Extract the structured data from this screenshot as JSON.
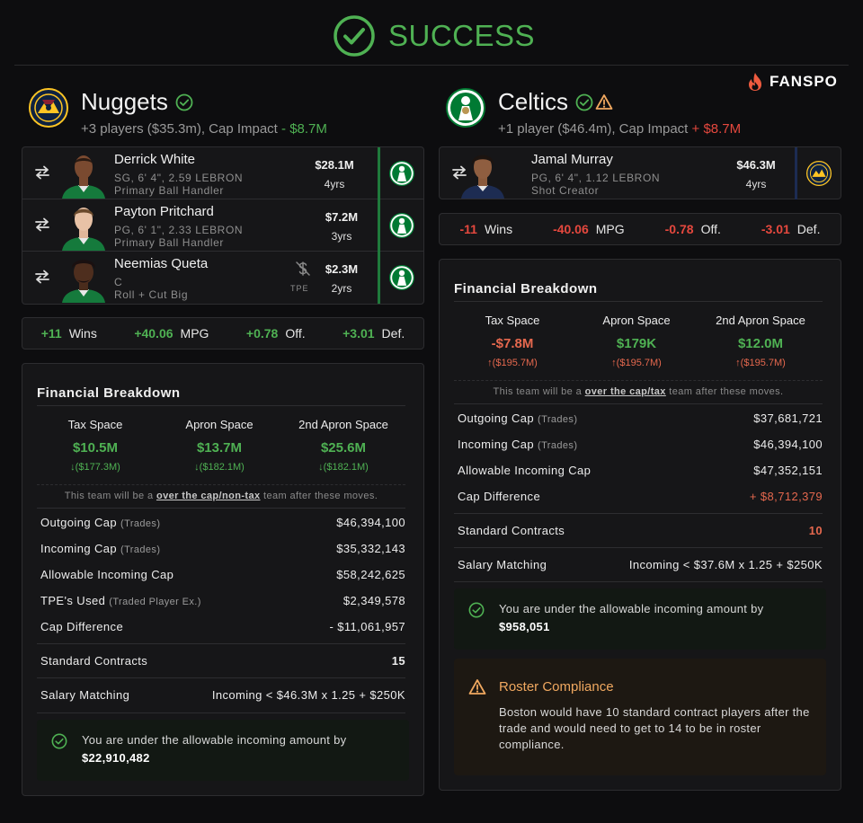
{
  "header": {
    "status": "SUCCESS",
    "brand": "FANSPO"
  },
  "colors": {
    "green": "#4fb153",
    "red": "#e5483e",
    "orange": "#f0a860",
    "nuggets_navy": "#0e2240",
    "nuggets_gold": "#fec524",
    "celtics_green": "#007a33"
  },
  "nuggets": {
    "name": "Nuggets",
    "summary_prefix": "+3 players ($35.3m), Cap Impact",
    "cap_impact": "- $8.7M",
    "players": [
      {
        "name": "Derrick White",
        "info": "SG, 6' 4\", 2.59 LEBRON",
        "role": "Primary Ball Handler",
        "salary": "$28.1M",
        "years": "4yrs",
        "tpe": ""
      },
      {
        "name": "Payton Pritchard",
        "info": "PG, 6' 1\", 2.33 LEBRON",
        "role": "Primary Ball Handler",
        "salary": "$7.2M",
        "years": "3yrs",
        "tpe": ""
      },
      {
        "name": "Neemias Queta",
        "info": "C",
        "role": "Roll + Cut Big",
        "salary": "$2.3M",
        "years": "2yrs",
        "tpe": "TPE"
      }
    ],
    "stats": [
      {
        "value": "+11",
        "label": "Wins"
      },
      {
        "value": "+40.06",
        "label": "MPG"
      },
      {
        "value": "+0.78",
        "label": "Off."
      },
      {
        "value": "+3.01",
        "label": "Def."
      }
    ],
    "financial": {
      "title": "Financial Breakdown",
      "spaces": [
        {
          "label": "Tax Space",
          "value": "$10.5M",
          "sub": "($177.3M)"
        },
        {
          "label": "Apron Space",
          "value": "$13.7M",
          "sub": "($182.1M)"
        },
        {
          "label": "2nd Apron Space",
          "value": "$25.6M",
          "sub": "($182.1M)"
        }
      ],
      "note_prefix": "This team will be a",
      "note_link": "over the cap/non-tax",
      "note_suffix": "team after these moves.",
      "rows": [
        {
          "label": "Outgoing Cap",
          "sub": "(Trades)",
          "value": "$46,394,100"
        },
        {
          "label": "Incoming Cap",
          "sub": "(Trades)",
          "value": "$35,332,143"
        },
        {
          "label": "Allowable Incoming Cap",
          "sub": "",
          "value": "$58,242,625"
        },
        {
          "label": "TPE's Used",
          "sub": "(Traded Player Ex.)",
          "value": "$2,349,578"
        },
        {
          "label": "Cap Difference",
          "sub": "",
          "value": "- $11,061,957"
        }
      ],
      "standard_contracts_label": "Standard Contracts",
      "standard_contracts_value": "15",
      "salary_matching_label": "Salary Matching",
      "salary_matching_value": "Incoming < $46.3M x 1.25 + $250K",
      "ok_text": "You are under the allowable incoming amount by",
      "ok_amount": "$22,910,482"
    }
  },
  "celtics": {
    "name": "Celtics",
    "summary_prefix": "+1 player ($46.4m), Cap Impact",
    "cap_impact": "+ $8.7M",
    "players": [
      {
        "name": "Jamal Murray",
        "info": "PG, 6' 4\", 1.12 LEBRON",
        "role": "Shot Creator",
        "salary": "$46.3M",
        "years": "4yrs",
        "tpe": ""
      }
    ],
    "stats": [
      {
        "value": "-11",
        "label": "Wins"
      },
      {
        "value": "-40.06",
        "label": "MPG"
      },
      {
        "value": "-0.78",
        "label": "Off."
      },
      {
        "value": "-3.01",
        "label": "Def."
      }
    ],
    "financial": {
      "title": "Financial Breakdown",
      "spaces": [
        {
          "label": "Tax Space",
          "value": "-$7.8M",
          "sub": "($195.7M)"
        },
        {
          "label": "Apron Space",
          "value": "$179K",
          "sub": "($195.7M)"
        },
        {
          "label": "2nd Apron Space",
          "value": "$12.0M",
          "sub": "($195.7M)"
        }
      ],
      "note_prefix": "This team will be a",
      "note_link": "over the cap/tax",
      "note_suffix": "team after these moves.",
      "rows": [
        {
          "label": "Outgoing Cap",
          "sub": "(Trades)",
          "value": "$37,681,721"
        },
        {
          "label": "Incoming Cap",
          "sub": "(Trades)",
          "value": "$46,394,100"
        },
        {
          "label": "Allowable Incoming Cap",
          "sub": "",
          "value": "$47,352,151"
        },
        {
          "label": "Cap Difference",
          "sub": "",
          "value": "+ $8,712,379"
        }
      ],
      "standard_contracts_label": "Standard Contracts",
      "standard_contracts_value": "10",
      "salary_matching_label": "Salary Matching",
      "salary_matching_value": "Incoming < $37.6M x 1.25 + $250K",
      "ok_text": "You are under the allowable incoming amount by",
      "ok_amount": "$958,051",
      "warn_title": "Roster Compliance",
      "warn_text": "Boston would have 10 standard contract players after the trade and would need to get to 14 to be in roster compliance."
    }
  }
}
